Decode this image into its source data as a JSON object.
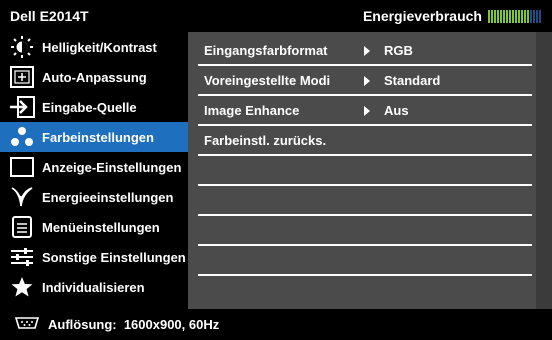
{
  "header": {
    "model": "Dell E2014T",
    "energy_label": "Energieverbrauch",
    "energy_level": 0.8
  },
  "sidebar": {
    "items": [
      {
        "label": "Helligkeit/Kontrast",
        "icon": "brightness-icon"
      },
      {
        "label": "Auto-Anpassung",
        "icon": "auto-adjust-icon"
      },
      {
        "label": "Eingabe-Quelle",
        "icon": "input-source-icon"
      },
      {
        "label": "Farbeinstellungen",
        "icon": "color-dots-icon",
        "selected": true
      },
      {
        "label": "Anzeige-Einstellungen",
        "icon": "display-icon"
      },
      {
        "label": "Energieeinstellungen",
        "icon": "energy-leaf-icon"
      },
      {
        "label": "Menüeinstellungen",
        "icon": "menu-icon"
      },
      {
        "label": "Sonstige Einstellungen",
        "icon": "sliders-icon"
      },
      {
        "label": "Individualisieren",
        "icon": "star-icon"
      }
    ]
  },
  "content": {
    "rows": [
      {
        "label": "Eingangsfarbformat",
        "value": "RGB"
      },
      {
        "label": "Voreingestellte Modi",
        "value": "Standard"
      },
      {
        "label": "Image Enhance",
        "value": "Aus"
      },
      {
        "label": "Farbeinstl. zurücks.",
        "value": ""
      }
    ]
  },
  "footer": {
    "resolution": "Auflösung:  1600x900, 60Hz",
    "icon": "vga-connector-icon"
  },
  "colors": {
    "selected": "#1f6fbf",
    "panel": "#4b4b4b",
    "energy_on": "#7ec832",
    "energy_off": "#1f4d86"
  }
}
